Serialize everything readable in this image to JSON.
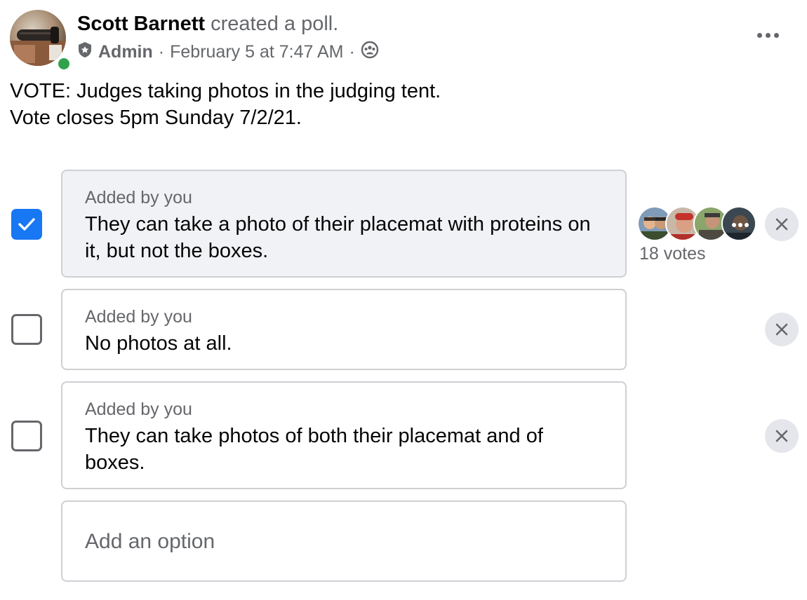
{
  "post": {
    "author": "Scott Barnett",
    "action": "created a poll.",
    "role": "Admin",
    "separator": "·",
    "timestamp": "February 5 at 7:47 AM",
    "audience_icon": "group-audience-icon",
    "more_icon": "more-options-icon",
    "text_lines": [
      "VOTE: Judges taking photos in the judging tent.",
      "Vote closes 5pm Sunday 7/2/21."
    ]
  },
  "poll": {
    "options": [
      {
        "added_by": "Added by you",
        "text": "They can take a photo of their placemat with proteins on it, but not the boxes.",
        "checked": true,
        "votes_label": "18 votes"
      },
      {
        "added_by": "Added by you",
        "text": "No photos at all.",
        "checked": false
      },
      {
        "added_by": "Added by you",
        "text": "They can take photos of both their placemat and of boxes.",
        "checked": false
      }
    ],
    "add_option_placeholder": "Add an option"
  },
  "colors": {
    "accent": "#1877f2",
    "secondary_text": "#65676b",
    "online": "#31a24c",
    "selected_bg": "#f0f2f5",
    "border": "#ced0d4"
  }
}
